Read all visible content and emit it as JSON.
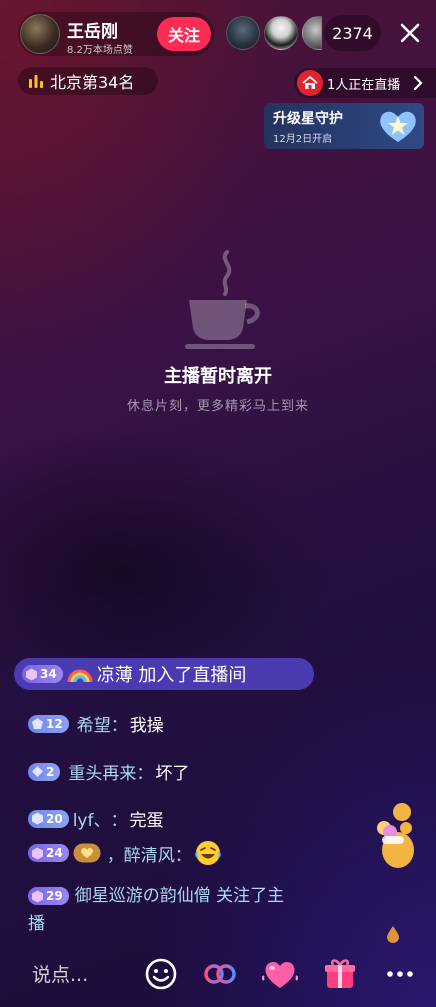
{
  "host": {
    "name": "王岳刚",
    "likes": "8.2万本场点赞",
    "follow_label": "关注"
  },
  "viewers": {
    "count": "2374"
  },
  "rank": {
    "label": "北京第34名"
  },
  "live_notice": {
    "text": "1人正在直播"
  },
  "guardian": {
    "title": "升级星守护",
    "date": "12月2日开启"
  },
  "away": {
    "title": "主播暂时离开",
    "subtitle": "休息片刻，更多精彩马上到来"
  },
  "chat": {
    "join": {
      "level": "34",
      "text": "凉薄 加入了直播间"
    },
    "messages": [
      {
        "level": "12",
        "user": "希望",
        "sep": "：",
        "text": "我操"
      },
      {
        "level": "2",
        "user": "重头再来",
        "sep": "：",
        "text": "坏了"
      },
      {
        "level": "20",
        "user": "lyf、",
        "sep": "：",
        "text": "完蛋"
      },
      {
        "level": "24",
        "user": "，醉清风",
        "sep": "：",
        "text": ""
      },
      {
        "level": "29",
        "user": "御星巡游の韵仙僧",
        "text": " 关注了主播"
      }
    ]
  },
  "bottom_bar": {
    "input_placeholder": "说点..."
  },
  "colors": {
    "follow": "#fe2c55",
    "join_bar": "#4b3bb0",
    "username": "#a9d7f5",
    "live_icon": "#e02331"
  }
}
